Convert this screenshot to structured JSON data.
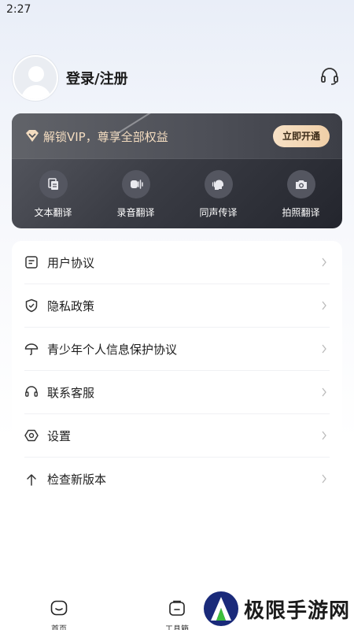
{
  "status_bar": {
    "time": "2:27"
  },
  "profile": {
    "login_label": "登录/注册"
  },
  "vip": {
    "title": "解锁VIP，尊享全部权益",
    "cta": "立即开通",
    "accent": "#f3dcc0",
    "features": [
      {
        "label": "文本翻译",
        "icon": "document-translate-icon"
      },
      {
        "label": "录音翻译",
        "icon": "voice-record-icon"
      },
      {
        "label": "同声传译",
        "icon": "speaker-head-icon"
      },
      {
        "label": "拍照翻译",
        "icon": "camera-icon"
      }
    ]
  },
  "menu": {
    "items": [
      {
        "label": "用户协议",
        "icon": "document-icon"
      },
      {
        "label": "隐私政策",
        "icon": "shield-check-icon"
      },
      {
        "label": "青少年个人信息保护协议",
        "icon": "umbrella-icon"
      },
      {
        "label": "联系客服",
        "icon": "headset-icon"
      },
      {
        "label": "设置",
        "icon": "hexagon-gear-icon"
      },
      {
        "label": "检查新版本",
        "icon": "arrow-up-icon"
      }
    ]
  },
  "bottom_nav": {
    "items": [
      {
        "label": "首页",
        "icon": "home-smile-icon"
      },
      {
        "label": "工具箱",
        "icon": "toolbox-icon"
      }
    ]
  },
  "watermark": {
    "text": "极限手游网"
  }
}
